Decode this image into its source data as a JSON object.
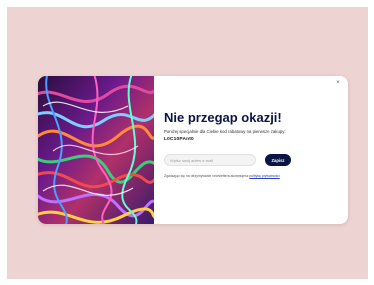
{
  "popup": {
    "title": "Nie przegap okazji!",
    "subtitle": "Poniżej specjalnie dla Ciebie kod rabatowy na pierwsze zakupy:",
    "discount_code": "L0C10PAnt0",
    "close_icon": "×",
    "email_input": {
      "placeholder": "Wpisz swój adres e-mail",
      "value": ""
    },
    "submit_label": "Zapisz",
    "consent_text": "Zgadzając się na otrzymywanie newslettera akceptujesz ",
    "consent_link": "politykę prywatności"
  },
  "colors": {
    "backdrop": "#eed3d3",
    "title": "#0b1545",
    "button": "#0b1545",
    "link": "#2b3fc4"
  },
  "icons": {
    "close": "close-icon"
  }
}
